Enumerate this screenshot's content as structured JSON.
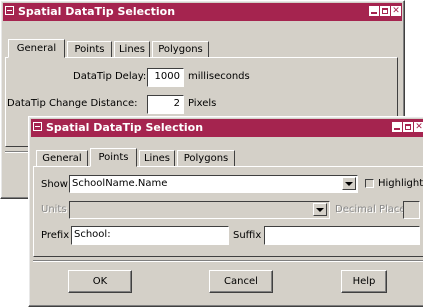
{
  "back_window": {
    "title": "Spatial DataTip Selection",
    "tabs": [
      "General",
      "Points",
      "Lines",
      "Polygons"
    ],
    "delay_label": "DataTip Delay:",
    "delay_value": "1000",
    "delay_unit": "milliseconds",
    "distance_label": "DataTip Change Distance:",
    "distance_value": "2",
    "distance_unit": "Pixels"
  },
  "front_window": {
    "title": "Spatial DataTip Selection",
    "tabs": [
      "General",
      "Points",
      "Lines",
      "Polygons"
    ],
    "active_tab": "Points",
    "show_label": "Show",
    "show_value": "SchoolName.Name",
    "highlight_label": "Highlight",
    "units_label": "Units",
    "units_value": "",
    "decimal_places_label": "Decimal Places",
    "decimal_places_value": "",
    "prefix_label": "Prefix",
    "prefix_value": "School:",
    "suffix_label": "Suffix",
    "suffix_value": "",
    "buttons": {
      "ok": "OK",
      "cancel": "Cancel",
      "help": "Help"
    }
  },
  "colors": {
    "titlebar": "#a5244f",
    "face": "#d4d0c8"
  },
  "icons": [
    "system-menu-icon",
    "minimize-icon",
    "maximize-icon",
    "close-icon",
    "dropdown-arrow-icon"
  ]
}
